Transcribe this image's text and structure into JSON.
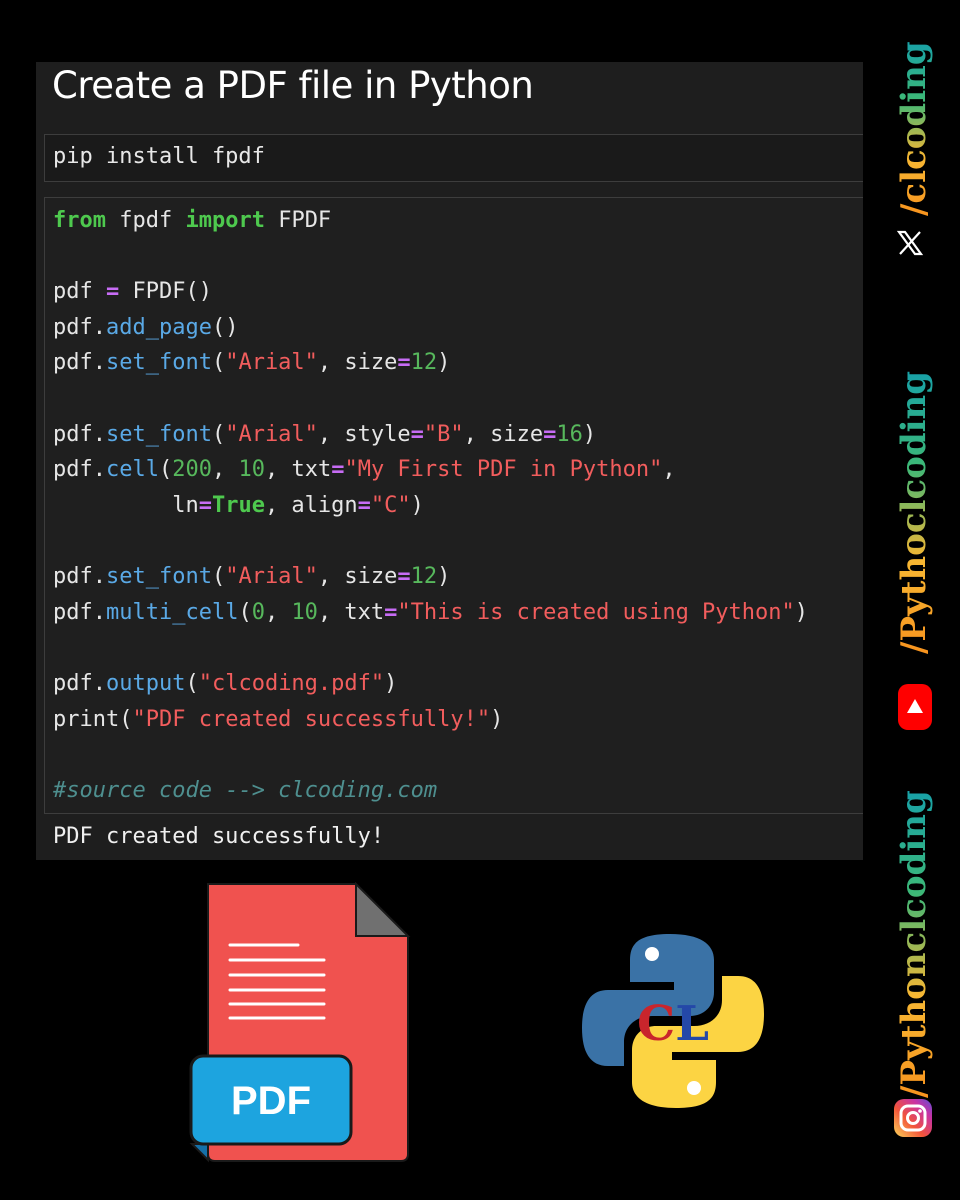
{
  "notebook": {
    "title": "Create a PDF file in Python",
    "install_cell": "pip install fpdf",
    "code_lines": [
      [
        {
          "t": "from",
          "c": "kw"
        },
        {
          "t": " fpdf ",
          "c": "tk"
        },
        {
          "t": "import",
          "c": "kw"
        },
        {
          "t": " FPDF",
          "c": "tk"
        }
      ],
      [],
      [
        {
          "t": "pdf ",
          "c": "tk"
        },
        {
          "t": "=",
          "c": "op"
        },
        {
          "t": " FPDF()",
          "c": "tk"
        }
      ],
      [
        {
          "t": "pdf.",
          "c": "tk"
        },
        {
          "t": "add_page",
          "c": "fn"
        },
        {
          "t": "()",
          "c": "tk"
        }
      ],
      [
        {
          "t": "pdf.",
          "c": "tk"
        },
        {
          "t": "set_font",
          "c": "fn"
        },
        {
          "t": "(",
          "c": "tk"
        },
        {
          "t": "\"Arial\"",
          "c": "st"
        },
        {
          "t": ", size",
          "c": "tk"
        },
        {
          "t": "=",
          "c": "op"
        },
        {
          "t": "12",
          "c": "nm"
        },
        {
          "t": ")",
          "c": "tk"
        }
      ],
      [],
      [
        {
          "t": "pdf.",
          "c": "tk"
        },
        {
          "t": "set_font",
          "c": "fn"
        },
        {
          "t": "(",
          "c": "tk"
        },
        {
          "t": "\"Arial\"",
          "c": "st"
        },
        {
          "t": ", style",
          "c": "tk"
        },
        {
          "t": "=",
          "c": "op"
        },
        {
          "t": "\"B\"",
          "c": "st"
        },
        {
          "t": ", size",
          "c": "tk"
        },
        {
          "t": "=",
          "c": "op"
        },
        {
          "t": "16",
          "c": "nm"
        },
        {
          "t": ")",
          "c": "tk"
        }
      ],
      [
        {
          "t": "pdf.",
          "c": "tk"
        },
        {
          "t": "cell",
          "c": "fn"
        },
        {
          "t": "(",
          "c": "tk"
        },
        {
          "t": "200",
          "c": "nm"
        },
        {
          "t": ", ",
          "c": "tk"
        },
        {
          "t": "10",
          "c": "nm"
        },
        {
          "t": ", txt",
          "c": "tk"
        },
        {
          "t": "=",
          "c": "op"
        },
        {
          "t": "\"My First PDF in Python\"",
          "c": "st"
        },
        {
          "t": ",",
          "c": "tk"
        }
      ],
      [
        {
          "t": "         ln",
          "c": "tk"
        },
        {
          "t": "=",
          "c": "op"
        },
        {
          "t": "True",
          "c": "kw"
        },
        {
          "t": ", align",
          "c": "tk"
        },
        {
          "t": "=",
          "c": "op"
        },
        {
          "t": "\"C\"",
          "c": "st"
        },
        {
          "t": ")",
          "c": "tk"
        }
      ],
      [],
      [
        {
          "t": "pdf.",
          "c": "tk"
        },
        {
          "t": "set_font",
          "c": "fn"
        },
        {
          "t": "(",
          "c": "tk"
        },
        {
          "t": "\"Arial\"",
          "c": "st"
        },
        {
          "t": ", size",
          "c": "tk"
        },
        {
          "t": "=",
          "c": "op"
        },
        {
          "t": "12",
          "c": "nm"
        },
        {
          "t": ")",
          "c": "tk"
        }
      ],
      [
        {
          "t": "pdf.",
          "c": "tk"
        },
        {
          "t": "multi_cell",
          "c": "fn"
        },
        {
          "t": "(",
          "c": "tk"
        },
        {
          "t": "0",
          "c": "nm"
        },
        {
          "t": ", ",
          "c": "tk"
        },
        {
          "t": "10",
          "c": "nm"
        },
        {
          "t": ", txt",
          "c": "tk"
        },
        {
          "t": "=",
          "c": "op"
        },
        {
          "t": "\"This is created using Python\"",
          "c": "st"
        },
        {
          "t": ")",
          "c": "tk"
        }
      ],
      [],
      [
        {
          "t": "pdf.",
          "c": "tk"
        },
        {
          "t": "output",
          "c": "fn"
        },
        {
          "t": "(",
          "c": "tk"
        },
        {
          "t": "\"clcoding.pdf\"",
          "c": "st"
        },
        {
          "t": ")",
          "c": "tk"
        }
      ],
      [
        {
          "t": "print(",
          "c": "tk"
        },
        {
          "t": "\"PDF created successfully!\"",
          "c": "st"
        },
        {
          "t": ")",
          "c": "tk"
        }
      ],
      [],
      [
        {
          "t": "#source code --> clcoding.com",
          "c": "cm"
        }
      ]
    ],
    "output_text": "PDF created successfully!"
  },
  "pdf_icon": {
    "badge_label": "PDF",
    "page_color": "#f0524f",
    "badge_color": "#1da4df",
    "fold_color": "#707070"
  },
  "python_logo": {
    "blue": "#3a72a6",
    "yellow": "#fcd443"
  },
  "social": {
    "x_handle": "/clcoding",
    "youtube_handle": "/Pythoclcoding",
    "instagram_handle": "/Pythonclcoding"
  },
  "colors": {
    "background": "#000000",
    "panel": "#1e1e1e"
  }
}
